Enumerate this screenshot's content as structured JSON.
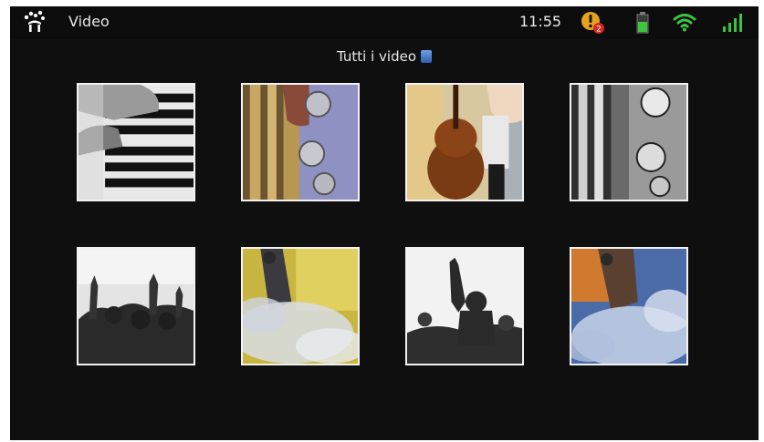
{
  "status_bar": {
    "app_title": "Video",
    "time": "11:55",
    "notification_count": "2",
    "icons": [
      "app-logo-icon",
      "alert-icon",
      "battery-icon",
      "wifi-icon",
      "signal-icon"
    ]
  },
  "gallery": {
    "title": "Tutti i video",
    "storage_icon": "sd-card-icon",
    "videos": [
      {
        "subject": "piano-keys"
      },
      {
        "subject": "saxophone-color"
      },
      {
        "subject": "cello-player"
      },
      {
        "subject": "saxophone-bw"
      },
      {
        "subject": "concert-crowd-bw"
      },
      {
        "subject": "stage-yellow-smoke"
      },
      {
        "subject": "crowd-silhouette"
      },
      {
        "subject": "stage-orange-blue"
      }
    ]
  },
  "colors": {
    "background": "#0f0f0f",
    "text": "#e8e8e8",
    "alert": "#e8a21b",
    "badge": "#d6281d",
    "battery": "#3cc63c",
    "wifi": "#3cc63c"
  }
}
